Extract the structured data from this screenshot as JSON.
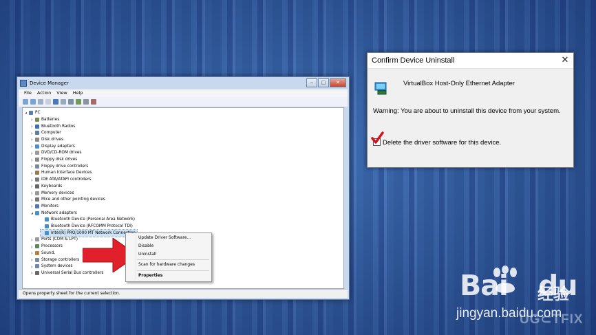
{
  "device_manager": {
    "title": "Device Manager",
    "menu": [
      "File",
      "Action",
      "View",
      "Help"
    ],
    "root": "PC",
    "tree": [
      {
        "label": "Batteries"
      },
      {
        "label": "Bluetooth Radios"
      },
      {
        "label": "Computer"
      },
      {
        "label": "Disk drives"
      },
      {
        "label": "Display adapters"
      },
      {
        "label": "DVD/CD-ROM drives"
      },
      {
        "label": "Floppy disk drives"
      },
      {
        "label": "Floppy drive controllers"
      },
      {
        "label": "Human Interface Devices"
      },
      {
        "label": "IDE ATA/ATAPI controllers"
      },
      {
        "label": "Keyboards"
      },
      {
        "label": "Memory devices"
      },
      {
        "label": "Mice and other pointing devices"
      },
      {
        "label": "Monitors"
      },
      {
        "label": "Network adapters"
      },
      {
        "label": "Bluetooth Device (Personal Area Network)"
      },
      {
        "label": "Bluetooth Device (RFCOMM Protocol TDI)"
      },
      {
        "label": "Intel(R) PRO/1000 MT Network Connection"
      },
      {
        "label": "Ports (COM & LPT)"
      },
      {
        "label": "Processors"
      },
      {
        "label": "Sound,"
      },
      {
        "label": "Storage controllers"
      },
      {
        "label": "System devices"
      },
      {
        "label": "Universal Serial Bus controllers"
      }
    ],
    "status": "Opens property sheet for the current selection."
  },
  "context_menu": {
    "items": [
      "Update Driver Software...",
      "Disable",
      "Uninstall",
      "Scan for hardware changes",
      "Properties"
    ]
  },
  "confirm_dialog": {
    "title": "Confirm Device Uninstall",
    "close_glyph": "✕",
    "device_name": "VirtualBox Host-Only Ethernet Adapter",
    "warning": "Warning: You are about to uninstall this device from your system.",
    "checkbox_label": "Delete the driver software for this device.",
    "checkbox_checked": true
  },
  "watermark": {
    "brand": "Bai",
    "brand_suffix": "du",
    "brand_cn": "经验",
    "site": "jingyan.baidu.com",
    "credit": "UG⊂TFIX"
  },
  "colors": {
    "arrow": "#e0202a",
    "checkmark": "#d4121b"
  }
}
